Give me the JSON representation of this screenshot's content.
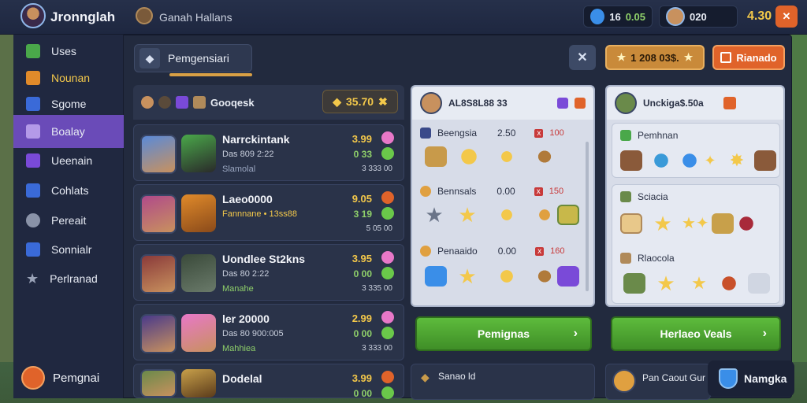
{
  "header": {
    "title": "Jronnglah",
    "subtitle": "Ganah Hallans",
    "stat_a": "16",
    "stat_b": "0.05",
    "player_value": "020",
    "gold": "4.30"
  },
  "sidebar": {
    "items": [
      {
        "label": "Uses",
        "icon": "green-square-icon"
      },
      {
        "label": "Nounan",
        "icon": "orange-box-icon"
      },
      {
        "label": "Sgome",
        "icon": "blue-box-icon"
      },
      {
        "label": "Boalay",
        "icon": "purple-box-icon",
        "active": true
      },
      {
        "label": "Ueenain",
        "icon": "purple-box-icon"
      },
      {
        "label": "Cohlats",
        "icon": "blue-doc-icon"
      },
      {
        "label": "Pereait",
        "icon": "chat-icon"
      },
      {
        "label": "Sonnialr",
        "icon": "blue-doc-icon"
      },
      {
        "label": "Perlranad",
        "icon": "star-icon"
      }
    ],
    "profile": "Pemgnai"
  },
  "tab": {
    "label": "Pemgensiari"
  },
  "top_buttons": {
    "close": "✕",
    "currency": "1 208 03$.",
    "action": "Rianado"
  },
  "list": {
    "header_label": "Gooqesk",
    "header_value": "35.70",
    "cards": [
      {
        "name": "Narrckintank",
        "line2": "Das 809 2:22",
        "line3": "Slamolal",
        "r1": "3.99",
        "r2": "0 33",
        "r3": "3 333 00"
      },
      {
        "name": "Laeo0000",
        "line2": "Fannnane • 13ss88",
        "line3": "",
        "r1": "9.05",
        "r2": "3 19",
        "r3": "5 05 00"
      },
      {
        "name": "Uondlee St2kns",
        "line2": "Das 80 2:22",
        "line3": "Manahe",
        "r1": "3.95",
        "r2": "0 00",
        "r3": "3 335 00"
      },
      {
        "name": "ler 20000",
        "line2": "Das 80 900:005",
        "line3": "Mahhiea",
        "r1": "2.99",
        "r2": "0 00",
        "r3": "3 333 00"
      },
      {
        "name": "Dodelal",
        "line2": "",
        "line3": "",
        "r1": "3.99",
        "r2": "0 00",
        "r3": ""
      }
    ]
  },
  "mid": {
    "header": "AL8S8L88 33",
    "rows": [
      {
        "label": "Beengsia",
        "value": "2.50",
        "tag": "100"
      },
      {
        "label": "Bennsals",
        "value": "0.00",
        "tag": "150"
      },
      {
        "label": "Penaaido",
        "value": "0.00",
        "tag": "160"
      }
    ],
    "button": "Pemignas",
    "bottom_label": "Sanao ld"
  },
  "right": {
    "header": "Unckiga$.50a",
    "sections": [
      "Pemhnan",
      "Sciacia",
      "Rlaocola"
    ],
    "button": "Herlaeo Veals",
    "bottom_label": "Pan Caout Gur"
  },
  "corner": {
    "label": "Namgka"
  }
}
